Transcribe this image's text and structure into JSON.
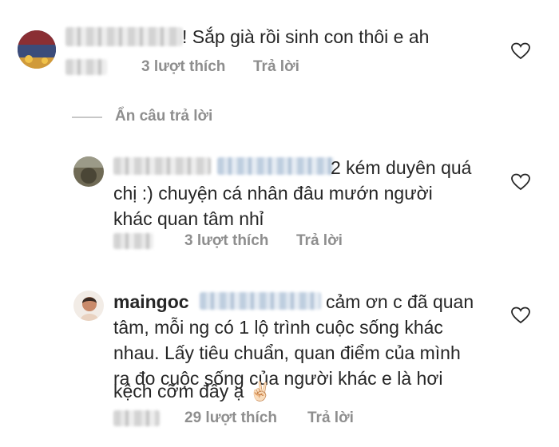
{
  "comments": [
    {
      "text": "! Sắp già rồi sinh con thôi e ah",
      "likes": "3 lượt thích",
      "reply": "Trả lời"
    },
    {
      "lines": [
        "2 kém duyên quá",
        "chị :) chuyện cá nhân đâu mướn người",
        "khác quan tâm nhỉ"
      ],
      "likes": "3 lượt thích",
      "reply": "Trả lời"
    },
    {
      "username": "maingoc",
      "lines": [
        "cảm ơn c đã quan",
        "tâm, mỗi ng có 1 lộ trình cuộc sống khác",
        "nhau. Lấy tiêu chuẩn, quan điểm của mình",
        "ra đo cuộc sống của người khác e là hơi",
        "kệch cỡm đấy ạ ✌🏻"
      ],
      "likes": "29 lượt thích",
      "reply": "Trả lời"
    }
  ],
  "hide_replies": "Ẩn câu trả lời",
  "icons": {
    "like": "heart-icon",
    "victory_emoji": "victory-hand-icon"
  },
  "colors": {
    "text": "#262626",
    "meta": "#8e8e8e",
    "divider": "#c7c7c7"
  }
}
